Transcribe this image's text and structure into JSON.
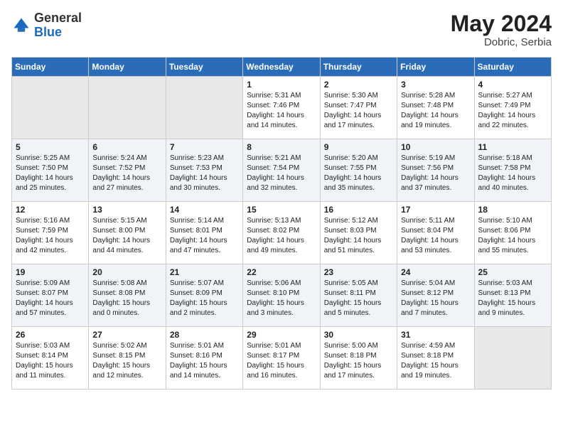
{
  "header": {
    "logo_general": "General",
    "logo_blue": "Blue",
    "month_year": "May 2024",
    "location": "Dobric, Serbia"
  },
  "weekdays": [
    "Sunday",
    "Monday",
    "Tuesday",
    "Wednesday",
    "Thursday",
    "Friday",
    "Saturday"
  ],
  "weeks": [
    [
      {
        "day": "",
        "empty": true
      },
      {
        "day": "",
        "empty": true
      },
      {
        "day": "",
        "empty": true
      },
      {
        "day": "1",
        "sunrise": "5:31 AM",
        "sunset": "7:46 PM",
        "daylight": "14 hours and 14 minutes."
      },
      {
        "day": "2",
        "sunrise": "5:30 AM",
        "sunset": "7:47 PM",
        "daylight": "14 hours and 17 minutes."
      },
      {
        "day": "3",
        "sunrise": "5:28 AM",
        "sunset": "7:48 PM",
        "daylight": "14 hours and 19 minutes."
      },
      {
        "day": "4",
        "sunrise": "5:27 AM",
        "sunset": "7:49 PM",
        "daylight": "14 hours and 22 minutes."
      }
    ],
    [
      {
        "day": "5",
        "sunrise": "5:25 AM",
        "sunset": "7:50 PM",
        "daylight": "14 hours and 25 minutes."
      },
      {
        "day": "6",
        "sunrise": "5:24 AM",
        "sunset": "7:52 PM",
        "daylight": "14 hours and 27 minutes."
      },
      {
        "day": "7",
        "sunrise": "5:23 AM",
        "sunset": "7:53 PM",
        "daylight": "14 hours and 30 minutes."
      },
      {
        "day": "8",
        "sunrise": "5:21 AM",
        "sunset": "7:54 PM",
        "daylight": "14 hours and 32 minutes."
      },
      {
        "day": "9",
        "sunrise": "5:20 AM",
        "sunset": "7:55 PM",
        "daylight": "14 hours and 35 minutes."
      },
      {
        "day": "10",
        "sunrise": "5:19 AM",
        "sunset": "7:56 PM",
        "daylight": "14 hours and 37 minutes."
      },
      {
        "day": "11",
        "sunrise": "5:18 AM",
        "sunset": "7:58 PM",
        "daylight": "14 hours and 40 minutes."
      }
    ],
    [
      {
        "day": "12",
        "sunrise": "5:16 AM",
        "sunset": "7:59 PM",
        "daylight": "14 hours and 42 minutes."
      },
      {
        "day": "13",
        "sunrise": "5:15 AM",
        "sunset": "8:00 PM",
        "daylight": "14 hours and 44 minutes."
      },
      {
        "day": "14",
        "sunrise": "5:14 AM",
        "sunset": "8:01 PM",
        "daylight": "14 hours and 47 minutes."
      },
      {
        "day": "15",
        "sunrise": "5:13 AM",
        "sunset": "8:02 PM",
        "daylight": "14 hours and 49 minutes."
      },
      {
        "day": "16",
        "sunrise": "5:12 AM",
        "sunset": "8:03 PM",
        "daylight": "14 hours and 51 minutes."
      },
      {
        "day": "17",
        "sunrise": "5:11 AM",
        "sunset": "8:04 PM",
        "daylight": "14 hours and 53 minutes."
      },
      {
        "day": "18",
        "sunrise": "5:10 AM",
        "sunset": "8:06 PM",
        "daylight": "14 hours and 55 minutes."
      }
    ],
    [
      {
        "day": "19",
        "sunrise": "5:09 AM",
        "sunset": "8:07 PM",
        "daylight": "14 hours and 57 minutes."
      },
      {
        "day": "20",
        "sunrise": "5:08 AM",
        "sunset": "8:08 PM",
        "daylight": "15 hours and 0 minutes."
      },
      {
        "day": "21",
        "sunrise": "5:07 AM",
        "sunset": "8:09 PM",
        "daylight": "15 hours and 2 minutes."
      },
      {
        "day": "22",
        "sunrise": "5:06 AM",
        "sunset": "8:10 PM",
        "daylight": "15 hours and 3 minutes."
      },
      {
        "day": "23",
        "sunrise": "5:05 AM",
        "sunset": "8:11 PM",
        "daylight": "15 hours and 5 minutes."
      },
      {
        "day": "24",
        "sunrise": "5:04 AM",
        "sunset": "8:12 PM",
        "daylight": "15 hours and 7 minutes."
      },
      {
        "day": "25",
        "sunrise": "5:03 AM",
        "sunset": "8:13 PM",
        "daylight": "15 hours and 9 minutes."
      }
    ],
    [
      {
        "day": "26",
        "sunrise": "5:03 AM",
        "sunset": "8:14 PM",
        "daylight": "15 hours and 11 minutes."
      },
      {
        "day": "27",
        "sunrise": "5:02 AM",
        "sunset": "8:15 PM",
        "daylight": "15 hours and 12 minutes."
      },
      {
        "day": "28",
        "sunrise": "5:01 AM",
        "sunset": "8:16 PM",
        "daylight": "15 hours and 14 minutes."
      },
      {
        "day": "29",
        "sunrise": "5:01 AM",
        "sunset": "8:17 PM",
        "daylight": "15 hours and 16 minutes."
      },
      {
        "day": "30",
        "sunrise": "5:00 AM",
        "sunset": "8:18 PM",
        "daylight": "15 hours and 17 minutes."
      },
      {
        "day": "31",
        "sunrise": "4:59 AM",
        "sunset": "8:18 PM",
        "daylight": "15 hours and 19 minutes."
      },
      {
        "day": "",
        "empty": true
      }
    ]
  ],
  "labels": {
    "sunrise": "Sunrise: ",
    "sunset": "Sunset: ",
    "daylight": "Daylight: "
  }
}
